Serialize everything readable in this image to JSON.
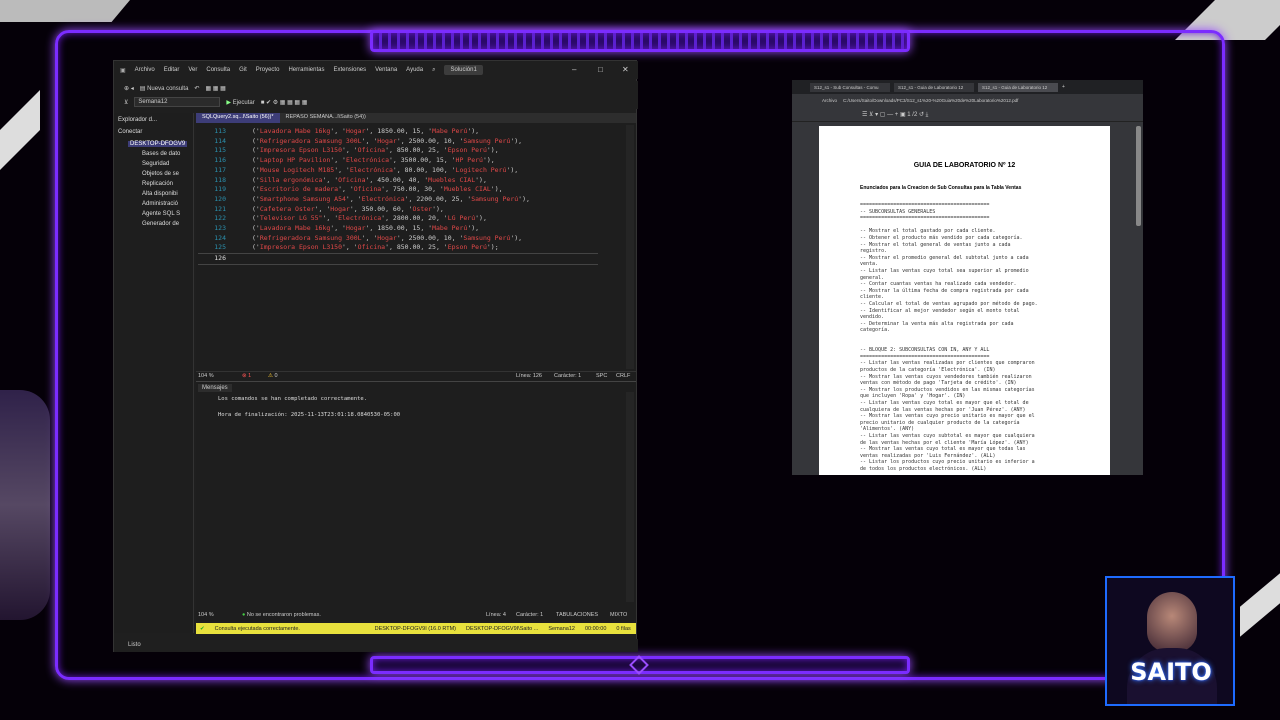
{
  "ssms": {
    "menu": [
      "Archivo",
      "Editar",
      "Ver",
      "Consulta",
      "Git",
      "Proyecto",
      "Herramientas",
      "Extensiones",
      "Ventana",
      "Ayuda"
    ],
    "solution": "Solución1",
    "toolbar1": {
      "new_query": "Nueva consulta"
    },
    "toolbar2": {
      "database": "Semana12",
      "execute": "Ejecutar"
    },
    "object_explorer": {
      "title": "Explorador d...",
      "connect": "Conectar",
      "server": "DESKTOP-DFOGV9",
      "nodes": [
        "Bases de dato",
        "Seguridad",
        "Objetos de se",
        "Replicación",
        "Alta disponibi",
        "Administració",
        "Agente SQL S",
        "Generador de"
      ]
    },
    "tabs": [
      "SQLQuery2.sq...l\\Saito (56))*",
      "REPASO SEMANA...l\\Saito (54))"
    ],
    "code_lines": [
      {
        "n": "113",
        "p": "Lavadora Mabe 16kg",
        "c": "Hogar",
        "price": "1850.00",
        "qty": "15",
        "prov": "Mabe Perú",
        "end": "),"
      },
      {
        "n": "114",
        "p": "Refrigeradora Samsung 300L",
        "c": "Hogar",
        "price": "2500.00",
        "qty": "10",
        "prov": "Samsung Perú",
        "end": "),"
      },
      {
        "n": "115",
        "p": "Impresora Epson L3150",
        "c": "Oficina",
        "price": "850.00",
        "qty": "25",
        "prov": "Epson Perú",
        "end": "),"
      },
      {
        "n": "116",
        "p": "Laptop HP Pavilion",
        "c": "Electrónica",
        "price": "3500.00",
        "qty": "15",
        "prov": "HP Perú",
        "end": "),"
      },
      {
        "n": "117",
        "p": "Mouse Logitech M185",
        "c": "Electrónica",
        "price": "80.00",
        "qty": "100",
        "prov": "Logitech Perú",
        "end": "),"
      },
      {
        "n": "118",
        "p": "Silla ergonómica",
        "c": "Oficina",
        "price": "450.00",
        "qty": "40",
        "prov": "Muebles CIAL",
        "end": "),"
      },
      {
        "n": "119",
        "p": "Escritorio de madera",
        "c": "Oficina",
        "price": "750.00",
        "qty": "30",
        "prov": "Muebles CIAL",
        "end": "),"
      },
      {
        "n": "120",
        "p": "Smartphone Samsung A54",
        "c": "Electrónica",
        "price": "2200.00",
        "qty": "25",
        "prov": "Samsung Perú",
        "end": "),"
      },
      {
        "n": "121",
        "p": "Cafetera Oster",
        "c": "Hogar",
        "price": "350.00",
        "qty": "60",
        "prov": "Oster",
        "end": "),"
      },
      {
        "n": "122",
        "p": "Televisor LG 55\"",
        "c": "Electrónica",
        "price": "2800.00",
        "qty": "20",
        "prov": "LG Perú",
        "end": "),"
      },
      {
        "n": "123",
        "p": "Lavadora Mabe 16kg",
        "c": "Hogar",
        "price": "1850.00",
        "qty": "15",
        "prov": "Mabe Perú",
        "end": "),"
      },
      {
        "n": "124",
        "p": "Refrigeradora Samsung 300L",
        "c": "Hogar",
        "price": "2500.00",
        "qty": "10",
        "prov": "Samsung Perú",
        "end": "),"
      },
      {
        "n": "125",
        "p": "Impresora Epson L3150",
        "c": "Oficina",
        "price": "850.00",
        "qty": "25",
        "prov": "Epson Perú",
        "end": ");"
      }
    ],
    "current_line": "126",
    "editor_status": {
      "zoom": "104 %",
      "errors": "1",
      "warnings": "0",
      "line": "Línea: 126",
      "char": "Carácter: 1",
      "spc": "SPC",
      "crlf": "CRLF"
    },
    "messages_tab": "Mensajes",
    "messages": [
      "Los comandos se han completado correctamente.",
      "Hora de finalización: 2025-11-13T23:01:18.0840530-05:00"
    ],
    "msg_status": {
      "zoom": "104 %",
      "issues": "No se encontraron problemas.",
      "line": "Línea: 4",
      "char": "Carácter: 1",
      "tabs": "TABULACIONES",
      "mixed": "MIXTO"
    },
    "query_status": {
      "ok": "Consulta ejecutada correctamente.",
      "server": "DESKTOP-DFOGV9I (16.0 RTM)",
      "user": "DESKTOP-DFOGV9I\\Saito ...",
      "db": "Semana12",
      "time": "00:00:00",
      "rows": "0 filas"
    },
    "app_status": "Listo"
  },
  "pdf": {
    "tabs": [
      "S12_s1 - Sub Consultas - Comu",
      "S12_s1 - Guia de Laboratorio 12",
      "S12_s1 - Guia de Laboratorio 12"
    ],
    "address": "C:/Users/Saito/Downloads/PC3/S12_s1%20-%20Guia%20de%20Laboratorio%2012.pdf",
    "address_label": "Archivo",
    "title": "GUIA DE LABORATORIO Nº 12",
    "subtitle": "Enunciados para la Creacion de Sub Consultas para la Tabla Ventas",
    "lines": [
      "===========================================",
      "-- SUBCONSULTAS GENERALES",
      "===========================================",
      "",
      "-- Mostrar el total gastado por cada cliente.",
      "-- Obtener el producto más vendido por cada categoría.",
      "-- Mostrar el total general de ventas junto a cada",
      "registro.",
      "-- Mostrar el promedio general del subtotal junto a cada",
      "venta.",
      "-- Listar las ventas cuyo total sea superior al promedio",
      "general.",
      "-- Contar cuantas ventas ha realizado cada vendedor.",
      "-- Mostrar la última fecha de compra registrada por cada",
      "cliente.",
      "-- Calcular el total de ventas agrupado por método de pago.",
      "-- Identificar al mejor vendedor según el monto total",
      "vendido.",
      "-- Determinar la venta más alta registrada por cada",
      "categoría.",
      "",
      "",
      "-- BLOQUE 2: SUBCONSULTAS CON IN, ANY Y ALL",
      "===========================================",
      "-- Listar las ventas realizadas por clientes que compraron",
      "productos de la categoría 'Electrónica'. (IN)",
      "-- Mostrar las ventas cuyos vendedores también realizaron",
      "ventas con método de pago 'Tarjeta de crédito'. (IN)",
      "-- Mostrar los productos vendidos en las mismas categorías",
      "que incluyen 'Ropa' y 'Hogar'. (IN)",
      "-- Listar las ventas cuyo total es mayor que el total de",
      "cualquiera de las ventas hechas por 'Juan Pérez'. (ANY)",
      "-- Mostrar las ventas cuyo precio unitario es mayor que el",
      "precio unitario de cualquier producto de la categoría",
      "'Alimentos'. (ANY)",
      "-- Listar las ventas cuyo subtotal es mayor que cualquiera",
      "de las ventas hechas por el cliente 'María López'. (ANY)",
      "-- Mostrar las ventas cuyo total es mayor que todas las",
      "ventas realizadas por 'Luis Fernández'. (ALL)",
      "-- Listar los productos cuyo precio unitario es inferior a",
      "de todos los productos electrónicos. (ALL)"
    ]
  },
  "webcam": {
    "name": "SAITO"
  },
  "colors": {
    "neon": "#7b2cff",
    "editor_bg": "#1e1e1e",
    "string": "#e04848",
    "status_yellow": "#e8e13d"
  }
}
